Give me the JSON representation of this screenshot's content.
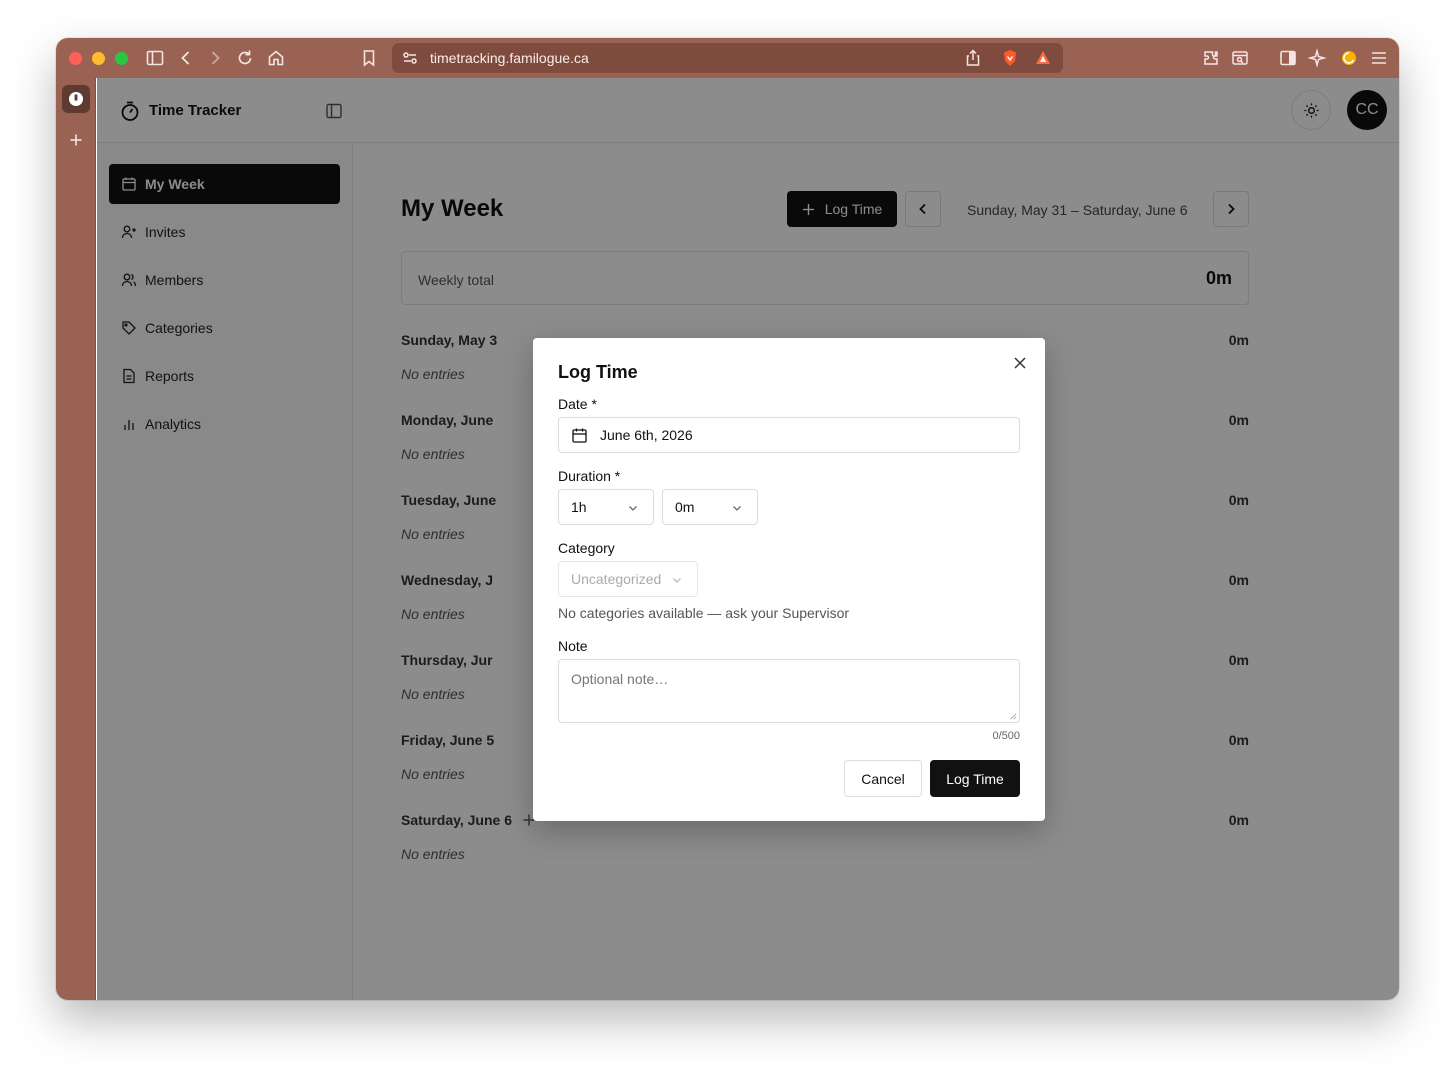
{
  "browser": {
    "url": "timetracking.familogue.ca"
  },
  "app": {
    "title": "Time Tracker",
    "avatar_initials": "CC"
  },
  "sidebar": {
    "items": [
      {
        "label": "My Week",
        "icon": "calendar-icon",
        "active": true
      },
      {
        "label": "Invites",
        "icon": "user-plus-icon",
        "active": false
      },
      {
        "label": "Members",
        "icon": "users-icon",
        "active": false
      },
      {
        "label": "Categories",
        "icon": "tag-icon",
        "active": false
      },
      {
        "label": "Reports",
        "icon": "file-text-icon",
        "active": false
      },
      {
        "label": "Analytics",
        "icon": "bar-chart-icon",
        "active": false
      }
    ]
  },
  "main": {
    "title": "My Week",
    "log_time_label": "Log Time",
    "date_range": "Sunday, May 31 – Saturday, June 6",
    "weekly_total_label": "Weekly total",
    "weekly_total_value": "0m",
    "days": [
      {
        "name": "Sunday, May 3",
        "total": "0m",
        "empty": "No entries"
      },
      {
        "name": "Monday, June",
        "total": "0m",
        "empty": "No entries"
      },
      {
        "name": "Tuesday, June",
        "total": "0m",
        "empty": "No entries"
      },
      {
        "name": "Wednesday, J",
        "total": "0m",
        "empty": "No entries"
      },
      {
        "name": "Thursday, Jur",
        "total": "0m",
        "empty": "No entries"
      },
      {
        "name": "Friday, June 5",
        "total": "0m",
        "empty": "No entries"
      },
      {
        "name": "Saturday, June 6",
        "total": "0m",
        "empty": "No entries"
      }
    ]
  },
  "modal": {
    "title": "Log Time",
    "date_label": "Date *",
    "date_value": "June 6th, 2026",
    "duration_label": "Duration *",
    "hours_value": "1h",
    "minutes_value": "0m",
    "category_label": "Category",
    "category_value": "Uncategorized",
    "category_hint": "No categories available — ask your Supervisor",
    "note_label": "Note",
    "note_placeholder": "Optional note…",
    "note_counter": "0/500",
    "cancel_label": "Cancel",
    "submit_label": "Log Time"
  },
  "colors": {
    "chrome": "#9a6252",
    "primary": "#111111"
  }
}
